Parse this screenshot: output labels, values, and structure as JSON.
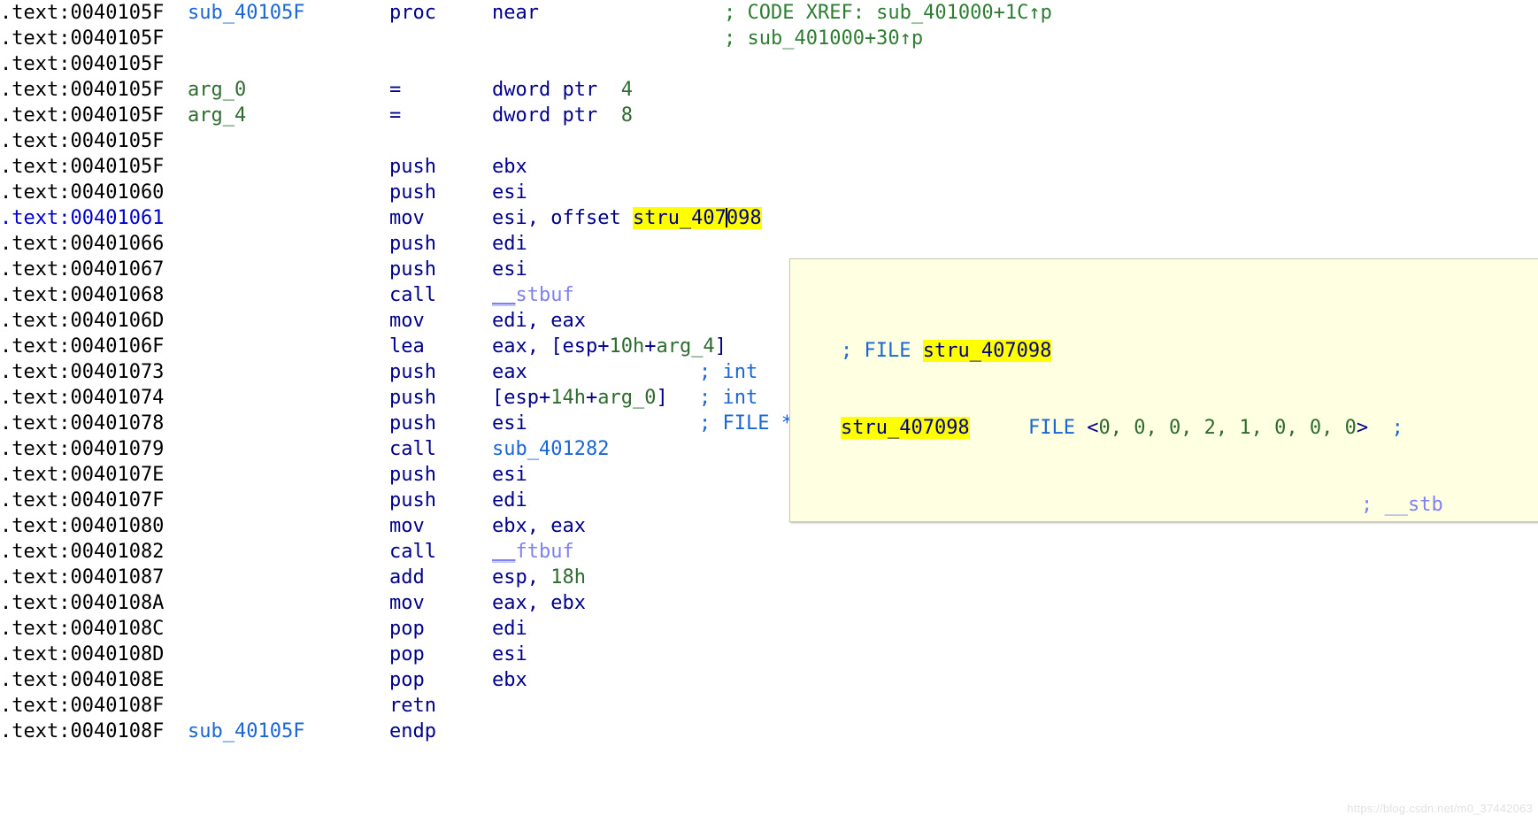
{
  "view": {
    "segment": "text",
    "highlighted_token": "stru_407098",
    "current_line_address": ".text:00401061"
  },
  "colors": {
    "background": "#ffffff",
    "address": "#000000",
    "address_current": "#0000d0",
    "identifier": "#1a66d6",
    "keyword": "#00008b",
    "number": "#2e6b2e",
    "comment": "#2e7d32",
    "auto_comment": "#1a66d6",
    "import": "#8080f0",
    "highlight_bg": "#ffff00",
    "hint_bg": "#ffffe1",
    "hint_border": "#c8c8b4"
  },
  "xrefs": [
    "; CODE XREF: sub_401000+1C↑p",
    "; sub_401000+30↑p"
  ],
  "lines": [
    {
      "address": ".text:0040105F",
      "current": false,
      "name": "sub_40105F",
      "name_class": "ident",
      "mnemonic": "proc",
      "mnemonic_class": "kw",
      "operands": "near",
      "operands_class": "kw",
      "comment": "; CODE XREF: sub_401000+1C↑p",
      "comment_class": "cmt"
    },
    {
      "address": ".text:0040105F",
      "current": false,
      "name": "",
      "mnemonic": "",
      "operands": "",
      "comment": "; sub_401000+30↑p",
      "comment_class": "cmt"
    },
    {
      "address": ".text:0040105F",
      "current": false,
      "name": "",
      "mnemonic": "",
      "operands": "",
      "comment": ""
    },
    {
      "address": ".text:0040105F",
      "current": false,
      "name": "arg_0",
      "name_class": "localvar",
      "mnemonic": "=",
      "mnemonic_class": "kw",
      "operands": "dword ptr  4",
      "operands_class": "kw",
      "comment": ""
    },
    {
      "address": ".text:0040105F",
      "current": false,
      "name": "arg_4",
      "name_class": "localvar",
      "mnemonic": "=",
      "mnemonic_class": "kw",
      "operands": "dword ptr  8",
      "operands_class": "kw",
      "comment": ""
    },
    {
      "address": ".text:0040105F",
      "current": false,
      "name": "",
      "mnemonic": "",
      "operands": "",
      "comment": ""
    },
    {
      "address": ".text:0040105F",
      "current": false,
      "name": "",
      "mnemonic": "push",
      "operands": "ebx",
      "comment": ""
    },
    {
      "address": ".text:00401060",
      "current": false,
      "name": "",
      "mnemonic": "push",
      "operands": "esi",
      "comment": ""
    },
    {
      "address": ".text:00401061",
      "current": true,
      "name": "",
      "mnemonic": "mov",
      "operands": "esi, offset stru_407098",
      "highlight": "stru_407098",
      "caret_after": "stru_407",
      "comment": ""
    },
    {
      "address": ".text:00401066",
      "current": false,
      "name": "",
      "mnemonic": "push",
      "operands": "edi",
      "comment": ""
    },
    {
      "address": ".text:00401067",
      "current": false,
      "name": "",
      "mnemonic": "push",
      "operands": "esi",
      "comment": ""
    },
    {
      "address": ".text:00401068",
      "current": false,
      "name": "",
      "mnemonic": "call",
      "operands": "__stbuf",
      "operands_class": "import",
      "comment": ""
    },
    {
      "address": ".text:0040106D",
      "current": false,
      "name": "",
      "mnemonic": "mov",
      "operands": "edi, eax",
      "comment": ""
    },
    {
      "address": ".text:0040106F",
      "current": false,
      "name": "",
      "mnemonic": "lea",
      "operands": "eax, [esp+10h+arg_4]",
      "comment": ""
    },
    {
      "address": ".text:00401073",
      "current": false,
      "name": "",
      "mnemonic": "push",
      "operands": "eax",
      "comment": "; int",
      "comment_class": "cmt-b"
    },
    {
      "address": ".text:00401074",
      "current": false,
      "name": "",
      "mnemonic": "push",
      "operands": "[esp+14h+arg_0]",
      "comment": "; int",
      "comment_class": "cmt-b"
    },
    {
      "address": ".text:00401078",
      "current": false,
      "name": "",
      "mnemonic": "push",
      "operands": "esi",
      "comment": "; FILE *",
      "comment_class": "cmt-b"
    },
    {
      "address": ".text:00401079",
      "current": false,
      "name": "",
      "mnemonic": "call",
      "operands": "sub_401282",
      "operands_class": "ident",
      "comment": ""
    },
    {
      "address": ".text:0040107E",
      "current": false,
      "name": "",
      "mnemonic": "push",
      "operands": "esi",
      "comment": ""
    },
    {
      "address": ".text:0040107F",
      "current": false,
      "name": "",
      "mnemonic": "push",
      "operands": "edi",
      "comment": ""
    },
    {
      "address": ".text:00401080",
      "current": false,
      "name": "",
      "mnemonic": "mov",
      "operands": "ebx, eax",
      "comment": ""
    },
    {
      "address": ".text:00401082",
      "current": false,
      "name": "",
      "mnemonic": "call",
      "operands": "__ftbuf",
      "operands_class": "import",
      "comment": ""
    },
    {
      "address": ".text:00401087",
      "current": false,
      "name": "",
      "mnemonic": "add",
      "operands": "esp, 18h",
      "comment": ""
    },
    {
      "address": ".text:0040108A",
      "current": false,
      "name": "",
      "mnemonic": "mov",
      "operands": "eax, ebx",
      "comment": ""
    },
    {
      "address": ".text:0040108C",
      "current": false,
      "name": "",
      "mnemonic": "pop",
      "operands": "edi",
      "comment": ""
    },
    {
      "address": ".text:0040108D",
      "current": false,
      "name": "",
      "mnemonic": "pop",
      "operands": "esi",
      "comment": ""
    },
    {
      "address": ".text:0040108E",
      "current": false,
      "name": "",
      "mnemonic": "pop",
      "operands": "ebx",
      "comment": ""
    },
    {
      "address": ".text:0040108F",
      "current": false,
      "name": "",
      "mnemonic": "retn",
      "operands": "",
      "comment": ""
    },
    {
      "address": ".text:0040108F",
      "current": false,
      "name": "sub_40105F",
      "name_class": "ident",
      "mnemonic": "endp",
      "mnemonic_class": "kw",
      "operands": "",
      "comment": ""
    }
  ],
  "hint": {
    "line1_prefix": "; FILE ",
    "line1_symbol": "stru_407098",
    "line2_symbol": "stru_407098",
    "line2_type": "FILE ",
    "line2_open": "<",
    "line2_values": "0, 0, 0, 2, 1, 0, 0, 0",
    "line2_close": ">",
    "line2_comment": ";",
    "line3_comment": "; __stb"
  },
  "watermark": "https://blog.csdn.net/m0_37442063"
}
